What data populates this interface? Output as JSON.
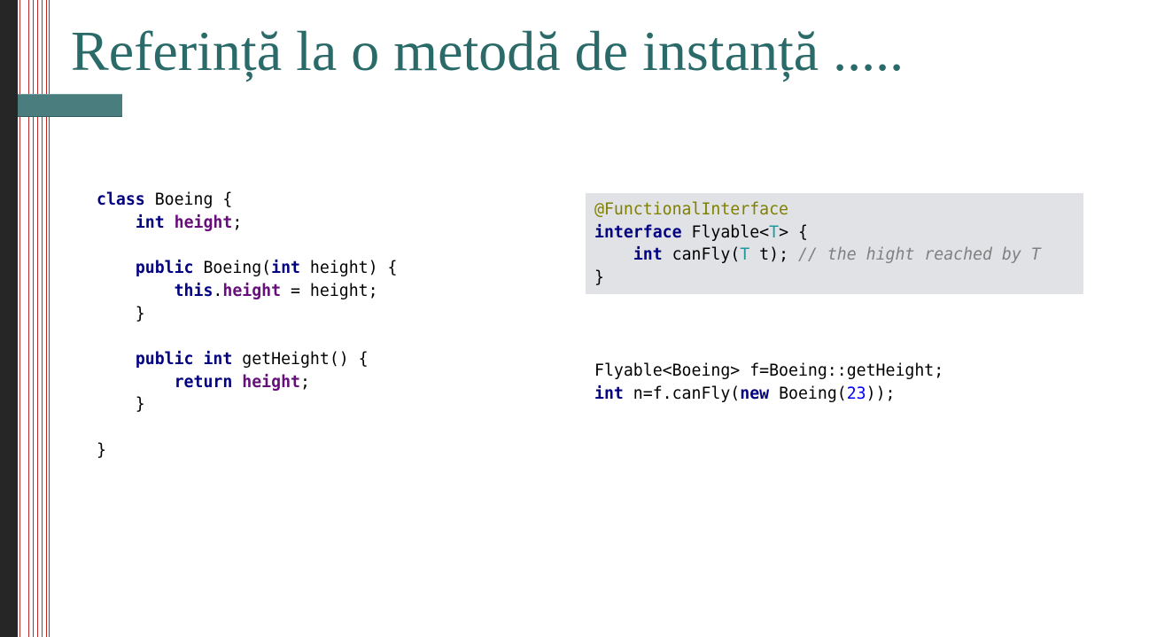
{
  "slide": {
    "title": "Referință la o metodă de instanță .....",
    "colors": {
      "title": "#2a6a69",
      "accent_bar": "#4a7d7e",
      "left_strip": "#262626",
      "code_box_bg": "#e0e2e5",
      "keyword": "#000080",
      "field": "#660e7a",
      "annotation": "#808000",
      "type_param": "#20999d",
      "comment": "#808080",
      "number": "#0000ff"
    }
  },
  "code_left": {
    "t1": "class",
    "t2": " Boeing {\n    ",
    "t3": "int",
    "t4": " ",
    "t5": "height",
    "t6": ";\n\n    ",
    "t7": "public",
    "t8": " Boeing(",
    "t9": "int",
    "t10": " height) {\n        ",
    "t11": "this",
    "t12": ".",
    "t13": "height",
    "t14": " = height;\n    }\n\n    ",
    "t15": "public",
    "t16": " ",
    "t17": "int",
    "t18": " getHeight() {\n        ",
    "t19": "return",
    "t20": " ",
    "t21": "height",
    "t22": ";\n    }\n\n}"
  },
  "code_iface": {
    "t1": "@FunctionalInterface",
    "t2": "\n",
    "t3": "interface",
    "t4": " Flyable<",
    "t5": "T",
    "t6": "> {\n    ",
    "t7": "int",
    "t8": " canFly(",
    "t9": "T",
    "t10": " t); ",
    "t11": "// the hight reached by T",
    "t12": "\n}"
  },
  "code_usage": {
    "t1": "Flyable<Boeing> f=Boeing::getHeight;\n",
    "t2": "int",
    "t3": " n=f.canFly(",
    "t4": "new",
    "t5": " Boeing(",
    "t6": "23",
    "t7": "));"
  }
}
